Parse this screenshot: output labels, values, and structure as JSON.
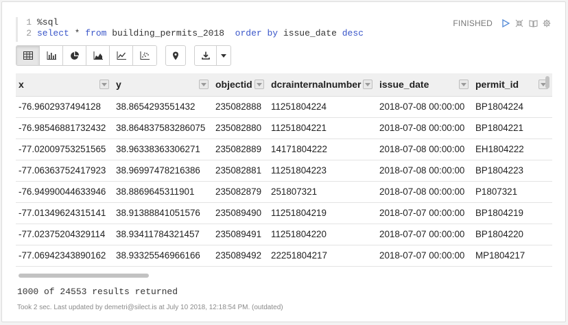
{
  "editor": {
    "lines": [
      {
        "num": "1",
        "text": "%sql"
      },
      {
        "num": "2",
        "kw1": "select",
        "star": " * ",
        "kw2": "from",
        "tbl": " building_permits_2018  ",
        "kw3": "order by",
        "col": " issue_date ",
        "kw4": "desc"
      }
    ]
  },
  "status": {
    "label": "FINISHED",
    "icons": [
      "play-icon",
      "collapse-icon",
      "book-icon",
      "gear-icon"
    ]
  },
  "toolbar": {
    "views": [
      "table-icon",
      "bar-chart-icon",
      "pie-chart-icon",
      "area-chart-icon",
      "line-chart-icon",
      "scatter-chart-icon"
    ],
    "active_view": "table-icon",
    "map_icon": "map-pin-icon",
    "download_icon": "download-icon"
  },
  "table": {
    "columns": [
      "x",
      "y",
      "objectid",
      "dcrainternalnumber",
      "issue_date",
      "permit_id"
    ],
    "rows": [
      [
        "-76.9602937494128",
        "38.8654293551432",
        "235082888",
        "11251804224",
        "2018-07-08 00:00:00",
        "BP1804224"
      ],
      [
        "-76.98546881732432",
        "38.864837583286075",
        "235082880",
        "11251804221",
        "2018-07-08 00:00:00",
        "BP1804221"
      ],
      [
        "-77.02009753251565",
        "38.96338363306271",
        "235082889",
        "14171804222",
        "2018-07-08 00:00:00",
        "EH1804222"
      ],
      [
        "-77.06363752417923",
        "38.96997478216386",
        "235082881",
        "11251804223",
        "2018-07-08 00:00:00",
        "BP1804223"
      ],
      [
        "-76.94990044633946",
        "38.8869645311901",
        "235082879",
        "251807321",
        "2018-07-08 00:00:00",
        "P1807321"
      ],
      [
        "-77.01349624315141",
        "38.91388841051576",
        "235089490",
        "11251804219",
        "2018-07-07 00:00:00",
        "BP1804219"
      ],
      [
        "-77.02375204329114",
        "38.93411784321457",
        "235089491",
        "11251804220",
        "2018-07-07 00:00:00",
        "BP1804220"
      ],
      [
        "-77.06942343890162",
        "38.93325546966166",
        "235089492",
        "22251804217",
        "2018-07-07 00:00:00",
        "MP1804217"
      ]
    ]
  },
  "results": {
    "text": "1000 of 24553 results returned"
  },
  "footer": {
    "text": "Took 2 sec. Last updated by demetri@silect.is at July 10 2018, 12:18:54 PM. (outdated)"
  },
  "colors": {
    "keyword": "#3a56c9",
    "icon": "#5a8fd8",
    "header_bg": "#f0f0f0"
  }
}
